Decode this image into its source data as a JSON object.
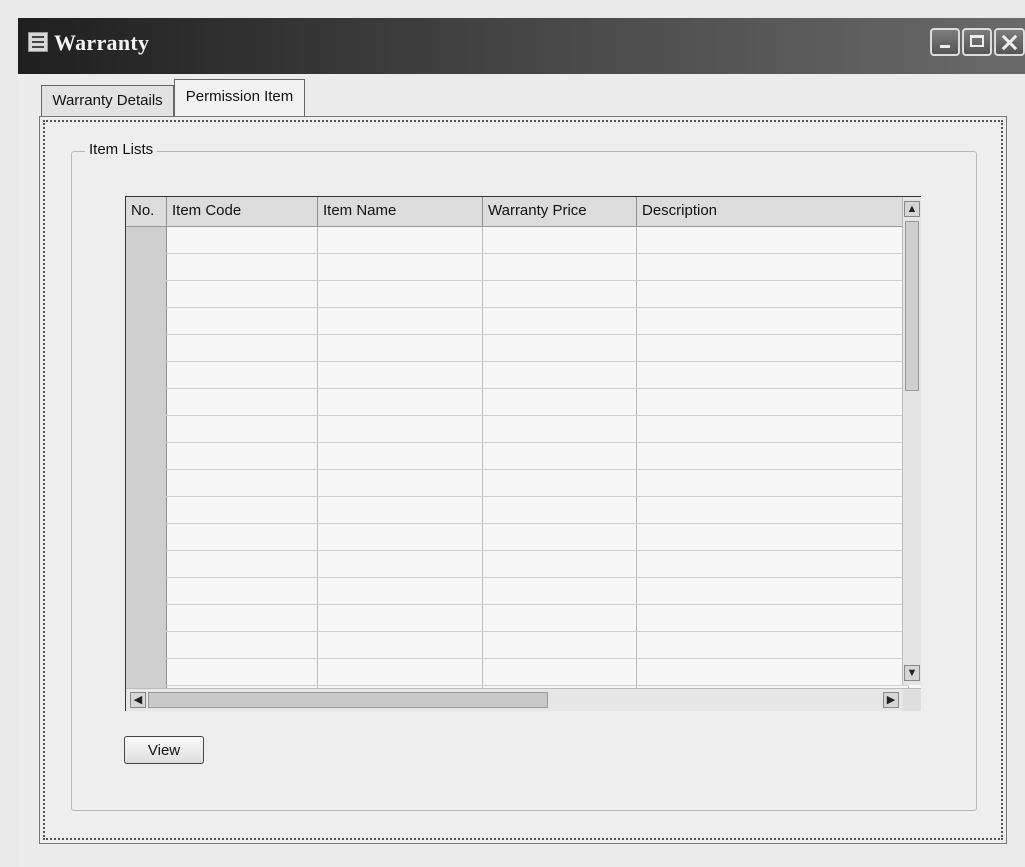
{
  "window": {
    "title": "Warranty"
  },
  "tabs": [
    {
      "label": "Warranty Details",
      "selected": false
    },
    {
      "label": "Permission Item",
      "selected": true
    }
  ],
  "group": {
    "legend": "Item Lists"
  },
  "grid": {
    "columns": [
      "No.",
      "Item Code",
      "Item Name",
      "Warranty Price",
      "Description"
    ],
    "visible_row_count": 18,
    "rows": []
  },
  "scroll": {
    "up_icon": "arrow-up-icon",
    "down_icon": "arrow-down-icon",
    "left_icon": "arrow-left-icon",
    "right_icon": "arrow-right-icon"
  },
  "buttons": {
    "view_label": "View"
  }
}
